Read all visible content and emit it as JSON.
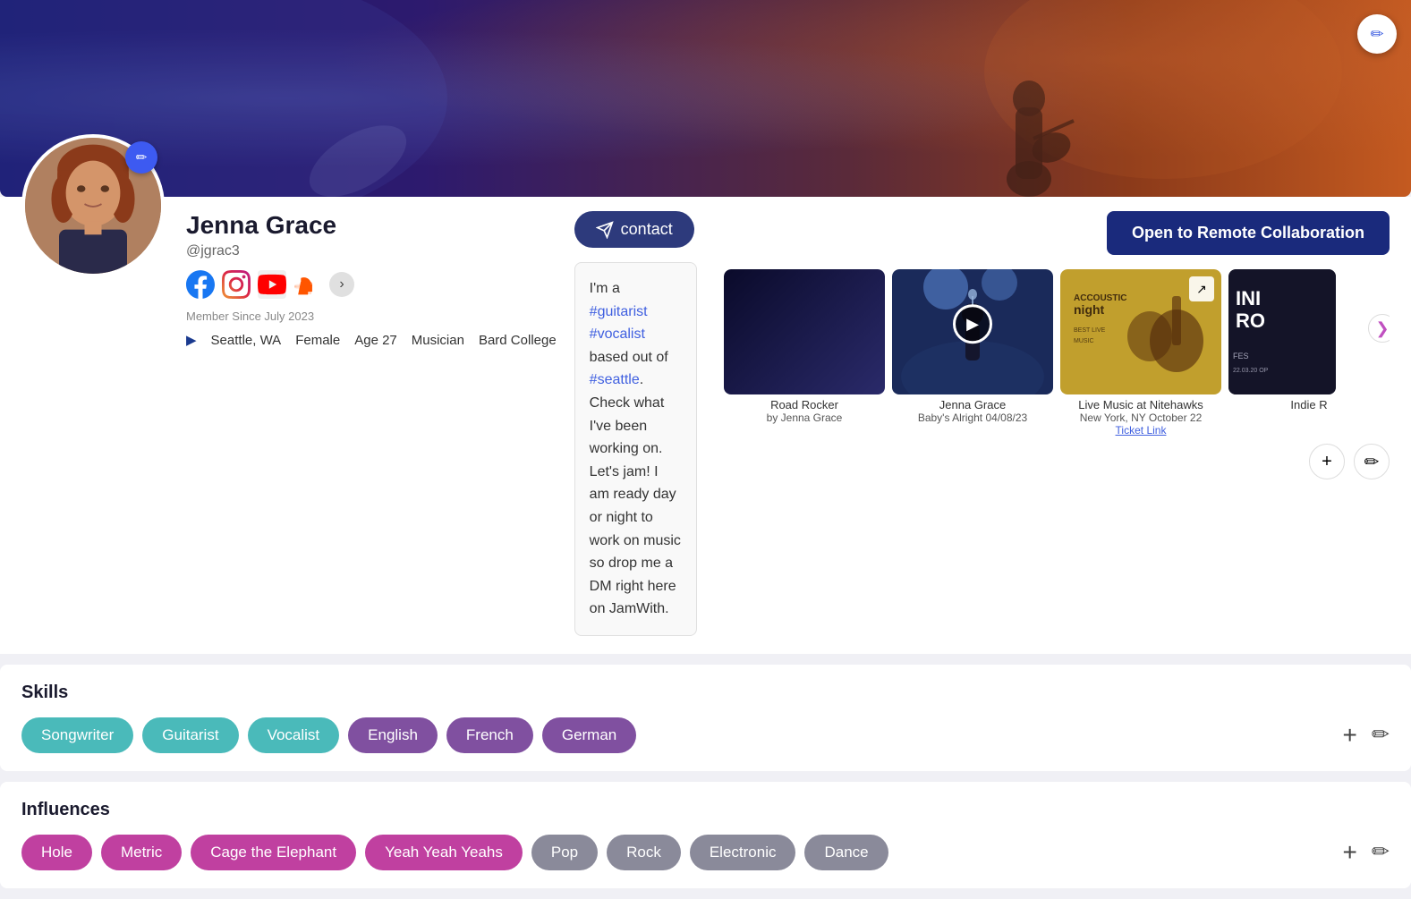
{
  "banner": {
    "edit_label": "✏"
  },
  "profile": {
    "name": "Jenna Grace",
    "handle": "@jgrac3",
    "member_since": "Member Since July 2023",
    "location": "Seattle, WA",
    "gender": "Female",
    "age": "Age 27",
    "occupation": "Musician",
    "education": "Bard College",
    "bio": "I'm a #guitarist #vocalist based out of #seattle. Check what I've been working on. Let's jam! I am ready day or night to work on music so drop me a DM right here on JamWith.",
    "bio_tags": [
      "#guitarist",
      "#vocalist",
      "#seattle"
    ],
    "contact_label": "contact",
    "remote_label": "Open to Remote Collaboration"
  },
  "media": {
    "items": [
      {
        "title": "Road Rocker",
        "subtitle": "by Jenna Grace",
        "type": "video",
        "theme": "dark"
      },
      {
        "title": "Jenna Grace",
        "subtitle": "Baby's Alright 04/08/23",
        "type": "video",
        "theme": "blue"
      },
      {
        "title": "Live Music at Nitehawks",
        "subtitle": "New York, NY October 22",
        "link": "Ticket Link",
        "type": "poster",
        "theme": "gold"
      },
      {
        "title": "Indie R",
        "subtitle": "",
        "type": "poster",
        "theme": "dark2"
      }
    ],
    "nav_next": "❯",
    "add_label": "+",
    "edit_label": "✏"
  },
  "skills": {
    "header": "Skills",
    "tags": [
      {
        "label": "Songwriter",
        "style": "teal"
      },
      {
        "label": "Guitarist",
        "style": "teal"
      },
      {
        "label": "Vocalist",
        "style": "teal"
      },
      {
        "label": "English",
        "style": "purple"
      },
      {
        "label": "French",
        "style": "purple"
      },
      {
        "label": "German",
        "style": "purple"
      }
    ],
    "add_label": "+",
    "edit_label": "✏"
  },
  "influences": {
    "header": "Influences",
    "tags": [
      {
        "label": "Hole",
        "style": "pink"
      },
      {
        "label": "Metric",
        "style": "pink"
      },
      {
        "label": "Cage the Elephant",
        "style": "pink"
      },
      {
        "label": "Yeah Yeah Yeahs",
        "style": "pink"
      },
      {
        "label": "Pop",
        "style": "gray"
      },
      {
        "label": "Rock",
        "style": "gray"
      },
      {
        "label": "Electronic",
        "style": "gray"
      },
      {
        "label": "Dance",
        "style": "gray"
      }
    ],
    "add_label": "+",
    "edit_label": "✏"
  },
  "social": {
    "icons": [
      "facebook",
      "instagram",
      "youtube",
      "soundcloud"
    ],
    "more_label": "›"
  }
}
